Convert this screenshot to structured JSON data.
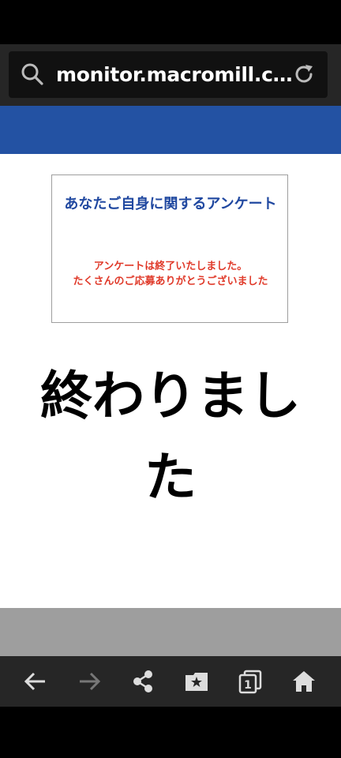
{
  "browser": {
    "url": "monitor.macromill.co...",
    "search_icon": "search-icon",
    "reload_icon": "reload-icon"
  },
  "notice": {
    "title": "あなたご自身に関するアンケート",
    "message_line1": "アンケートは終了いたしました。",
    "message_line2": "たくさんのご応募ありがとうございました"
  },
  "main": {
    "finish_text": "終わりました"
  },
  "nav": {
    "items": [
      "back-icon",
      "forward-icon",
      "share-icon",
      "bookmarks-icon",
      "tabs-icon",
      "home-icon"
    ],
    "tab_count": "1"
  },
  "colors": {
    "header": "#2352a3",
    "title": "#2048a0",
    "message": "#e03a2a",
    "toolbar": "#262626"
  }
}
